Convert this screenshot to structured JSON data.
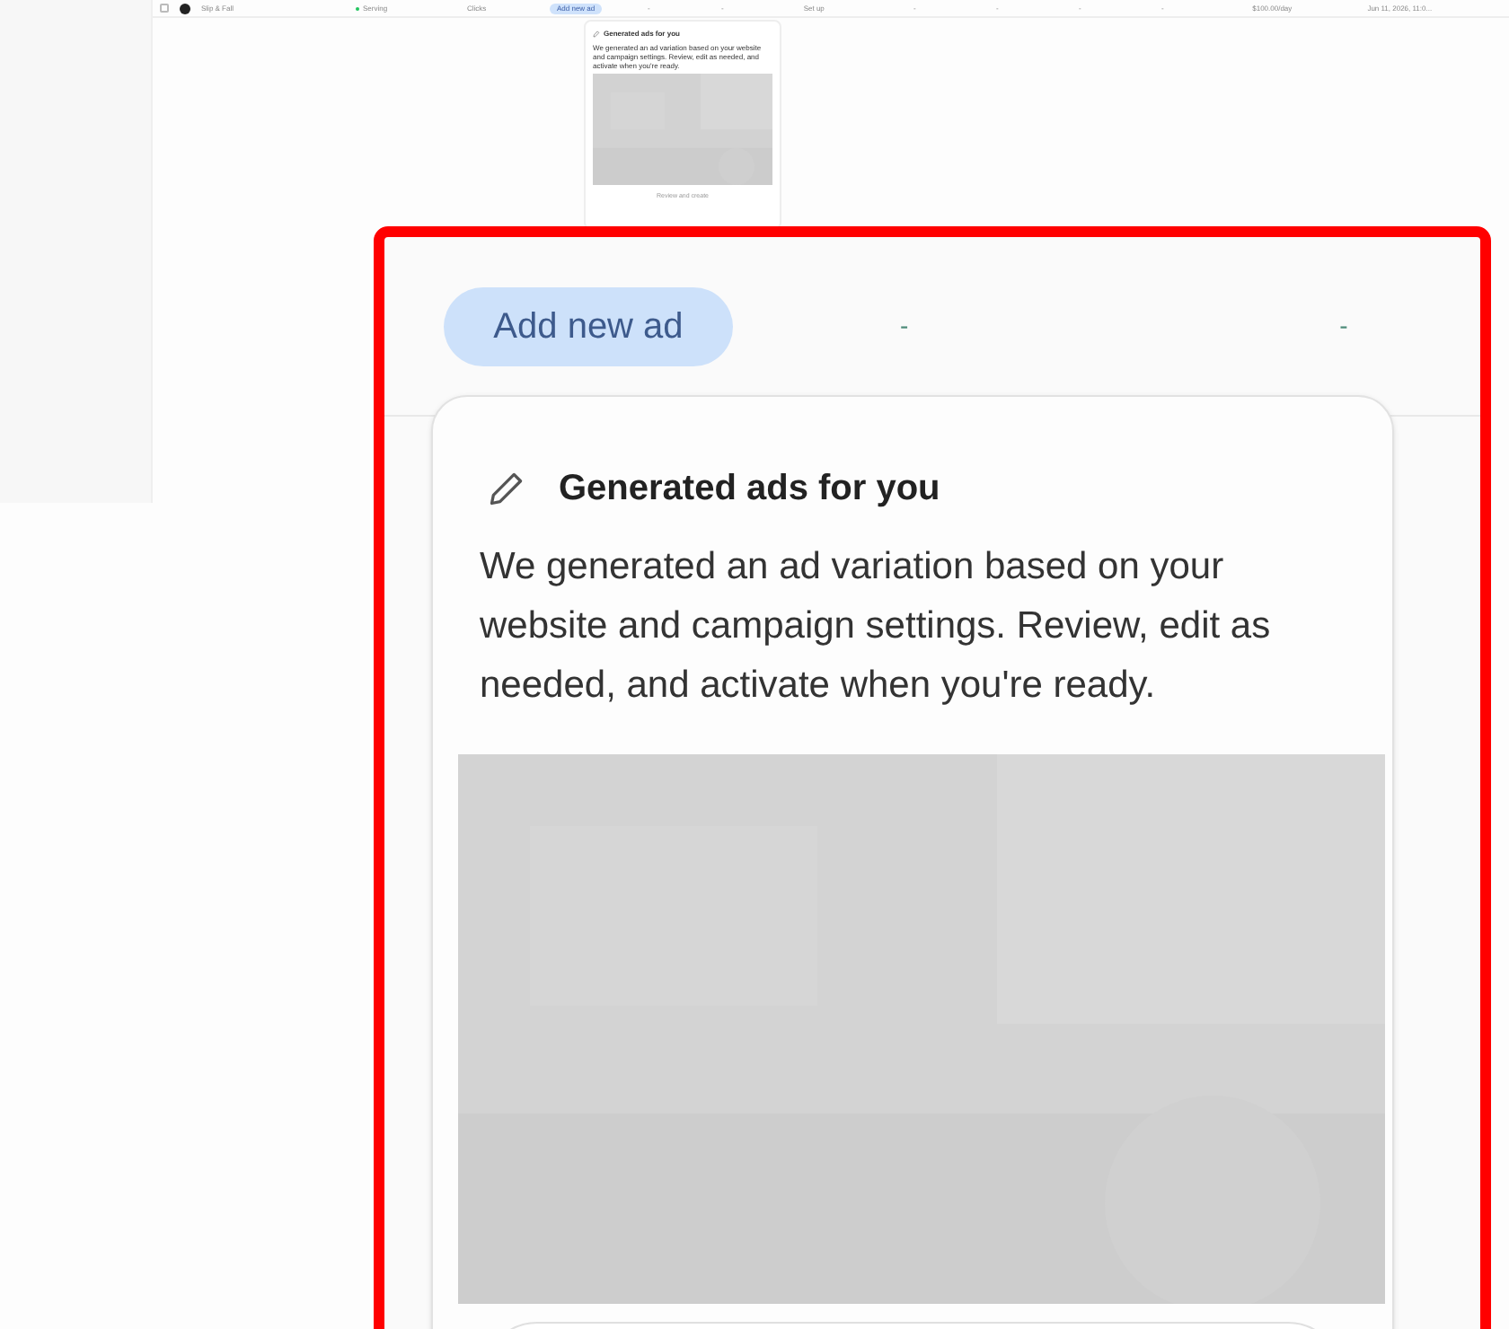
{
  "table_row": {
    "checked": false,
    "name": "Slip & Fall",
    "status": {
      "text": "Serving",
      "color": "#22c55e"
    },
    "metric": "Clicks",
    "add_button": "Add new ad",
    "cells": [
      "-",
      "-",
      "Set up",
      "-",
      "-",
      "-",
      "-",
      "$100.00/day",
      "Jun 11, 2026, 11:0..."
    ]
  },
  "preview_card": {
    "title": "Generated ads for you",
    "body": "We generated an ad variation based on your website and campaign settings. Review, edit as needed, and activate when you're ready.",
    "button": "Review and create"
  },
  "zoom_inset": {
    "add_button": "Add new ad",
    "cells": [
      "-",
      "-"
    ],
    "card": {
      "title": "Generated ads for you",
      "body": "We generated an ad variation based on your website and campaign settings. Review, edit as needed, and activate when you're ready."
    }
  }
}
